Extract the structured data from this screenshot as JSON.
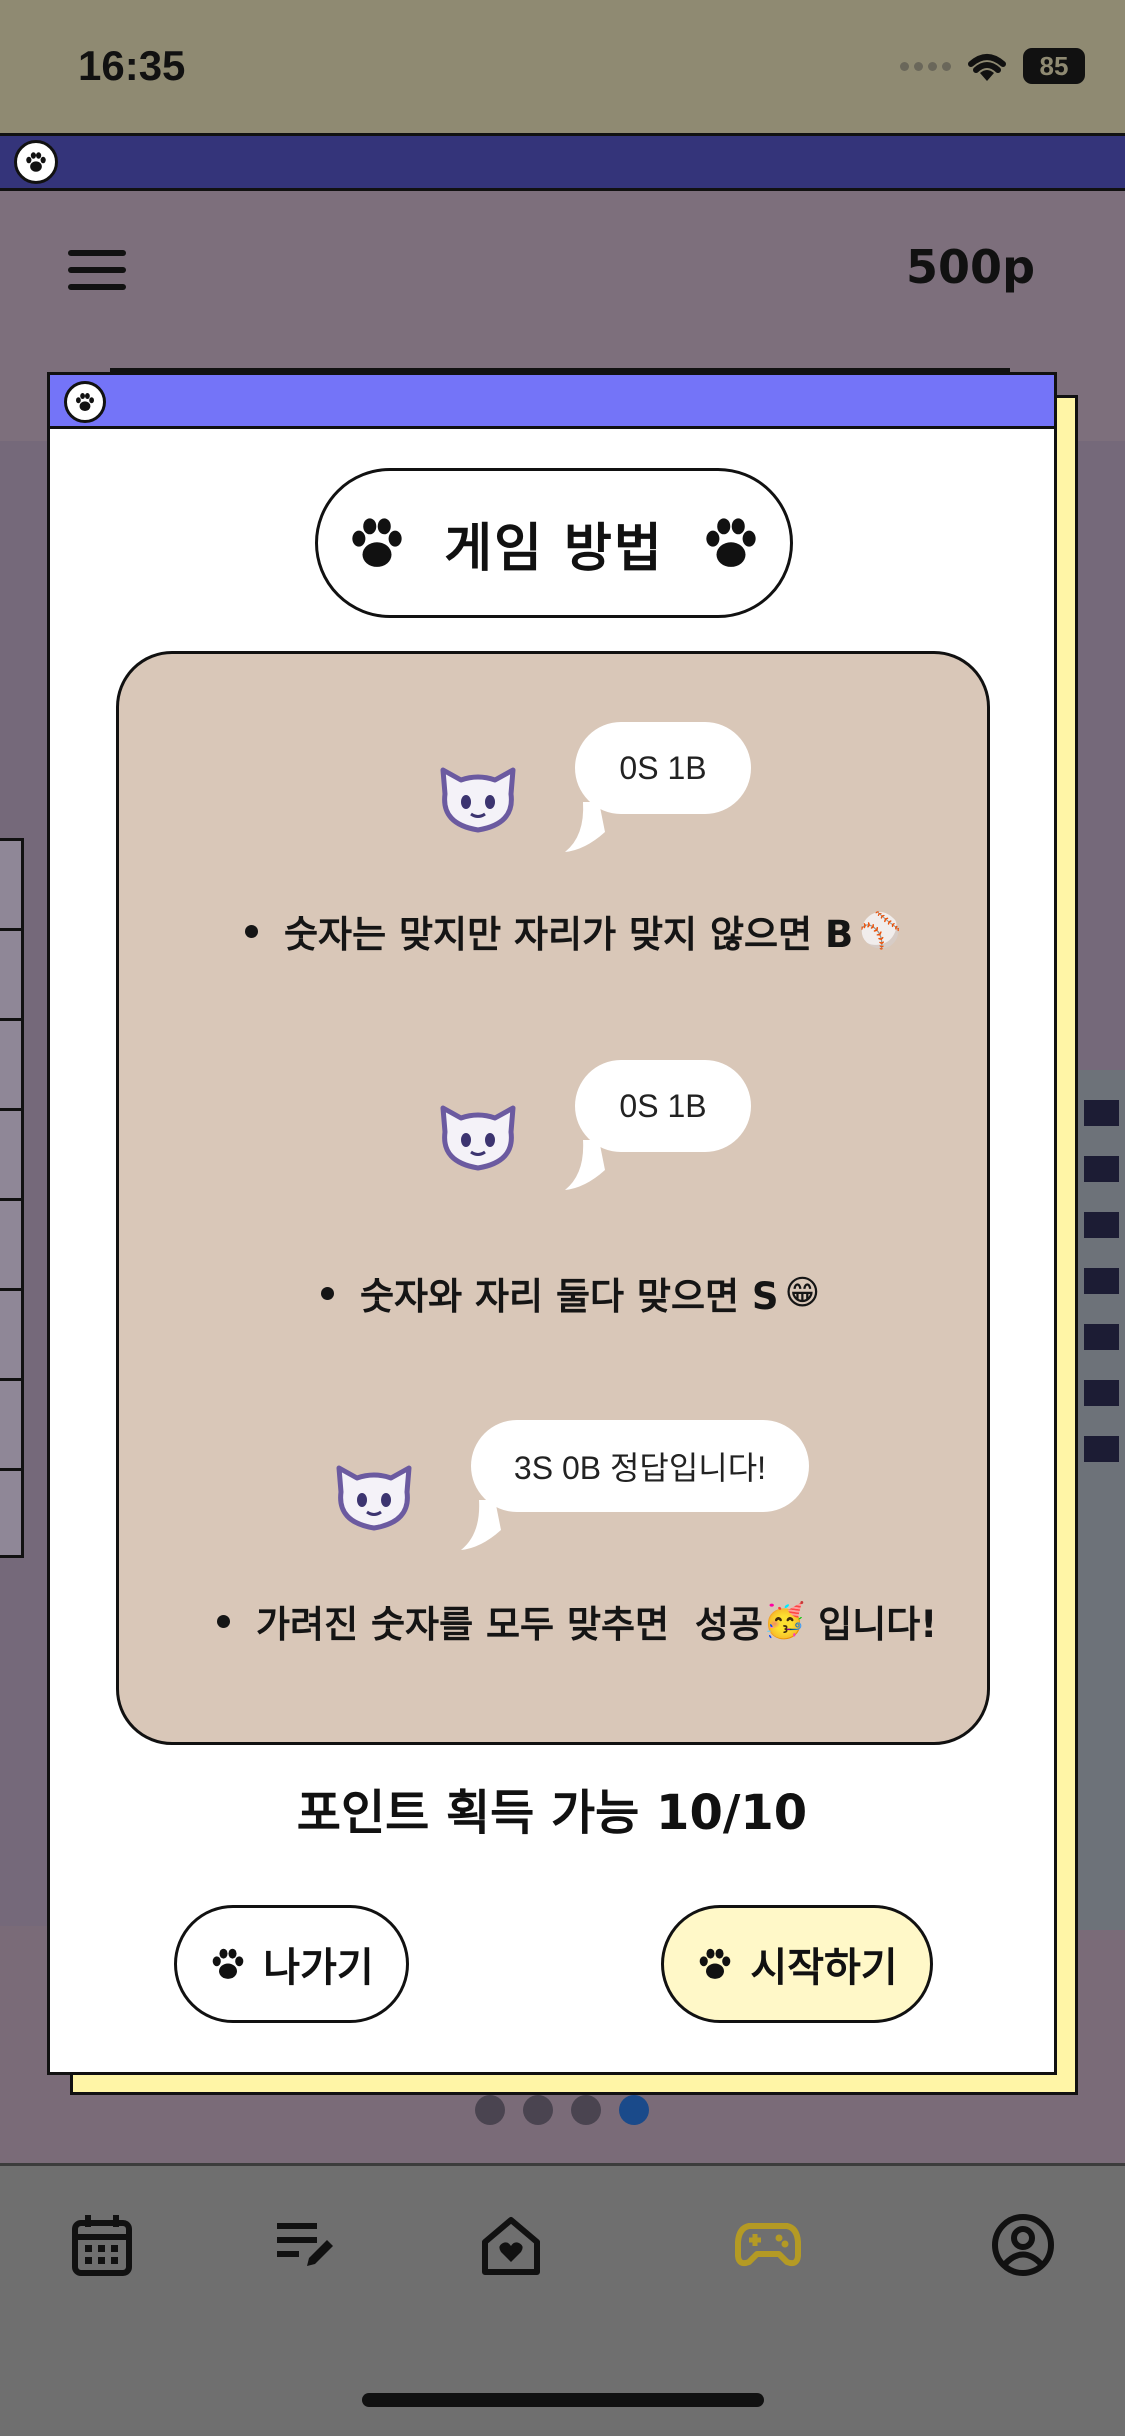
{
  "status_bar": {
    "time": "16:35",
    "battery": "85"
  },
  "header": {
    "points": "500p"
  },
  "modal": {
    "title": "게임 방법",
    "rules": [
      {
        "bubble": "0S 1B",
        "text": "숫자는 맞지만 자리가 맞지 않으면 B",
        "emoji": "⚾"
      },
      {
        "bubble": "0S 1B",
        "text": "숫자와 자리 둘다 맞으면 S",
        "emoji": "😁"
      },
      {
        "bubble": "3S 0B 정답입니다!",
        "text": "가려진 숫자를 모두 맞추면  성공",
        "emoji": "🥳",
        "suffix": " 입니다!"
      }
    ],
    "points_available": "포인트 획득 가능 10/10",
    "exit_label": "나가기",
    "start_label": "시작하기"
  },
  "pager": {
    "count": 4,
    "active_index": 3
  },
  "tab_bar": {
    "items": [
      {
        "icon": "calendar-icon"
      },
      {
        "icon": "edit-list-icon"
      },
      {
        "icon": "home-heart-icon"
      },
      {
        "icon": "gamepad-icon",
        "active": true
      },
      {
        "icon": "profile-icon"
      }
    ],
    "active_color": "#b49a24"
  },
  "colors": {
    "modal_titlebar": "#7474f8",
    "rules_panel": "#d9c7b8",
    "start_button": "#fff8c8",
    "modal_shadow": "#fff5a6"
  }
}
